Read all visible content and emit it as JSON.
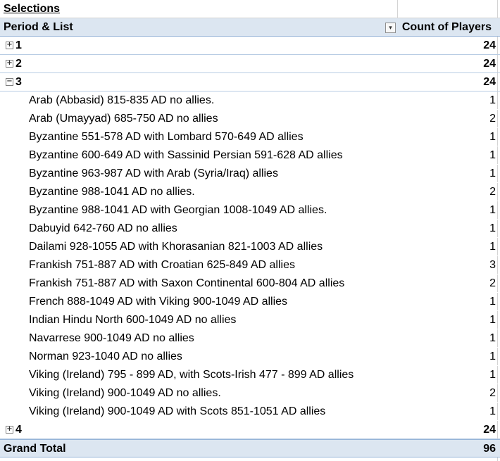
{
  "title": "Selections",
  "header": {
    "row_label": "Period & List",
    "value_label": "Count of Players"
  },
  "groups_before": [
    {
      "label": "1",
      "count": "24",
      "state": "collapsed"
    },
    {
      "label": "2",
      "count": "24",
      "state": "collapsed"
    }
  ],
  "expanded_group": {
    "label": "3",
    "count": "24",
    "state": "expanded",
    "items": [
      {
        "label": "Arab (Abbasid) 815-835 AD no allies.",
        "count": "1"
      },
      {
        "label": "Arab (Umayyad) 685-750 AD no allies",
        "count": "2"
      },
      {
        "label": "Byzantine 551-578 AD with Lombard 570-649 AD allies",
        "count": "1"
      },
      {
        "label": "Byzantine 600-649 AD with Sassinid Persian 591-628 AD allies",
        "count": "1"
      },
      {
        "label": "Byzantine 963-987 AD with Arab (Syria/Iraq) allies",
        "count": "1"
      },
      {
        "label": "Byzantine 988-1041 AD no allies.",
        "count": "2"
      },
      {
        "label": "Byzantine 988-1041 AD with Georgian 1008-1049 AD allies.",
        "count": "1"
      },
      {
        "label": "Dabuyid  642-760 AD no allies",
        "count": "1"
      },
      {
        "label": "Dailami 928-1055 AD with Khorasanian 821-1003 AD allies",
        "count": "1"
      },
      {
        "label": "Frankish 751-887 AD with Croatian 625-849 AD allies",
        "count": "3"
      },
      {
        "label": "Frankish 751-887 AD with Saxon Continental 600-804 AD allies",
        "count": "2"
      },
      {
        "label": "French 888-1049 AD with Viking 900-1049 AD allies",
        "count": "1"
      },
      {
        "label": "Indian Hindu North 600-1049 AD no allies",
        "count": "1"
      },
      {
        "label": "Navarrese 900-1049 AD no allies",
        "count": "1"
      },
      {
        "label": "Norman 923-1040 AD no allies",
        "count": "1"
      },
      {
        "label": "Viking (Ireland) 795 - 899 AD, with Scots-Irish 477 - 899 AD allies",
        "count": "1"
      },
      {
        "label": "Viking (Ireland) 900-1049 AD no allies.",
        "count": "2"
      },
      {
        "label": "Viking (Ireland) 900-1049 AD with Scots 851-1051 AD allies",
        "count": "1"
      }
    ]
  },
  "groups_after": [
    {
      "label": "4",
      "count": "24",
      "state": "collapsed"
    }
  ],
  "grand_total": {
    "label": "Grand Total",
    "count": "96"
  },
  "icons": {
    "expand": "plus-box-icon",
    "collapse": "minus-box-icon",
    "filter": "filter-dropdown-icon"
  }
}
